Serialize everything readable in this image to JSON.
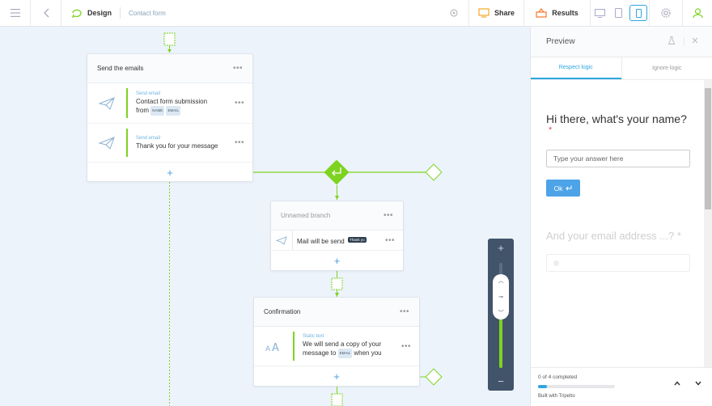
{
  "topbar": {
    "design_label": "Design",
    "form_name": "Contact form",
    "share_label": "Share",
    "results_label": "Results"
  },
  "canvas": {
    "send_block": {
      "title": "Send the emails",
      "items": [
        {
          "type": "Send email",
          "text_line1": "Contact form submission",
          "text_from": "from",
          "tag_name": "NAME",
          "tag_email": "EMAIL"
        },
        {
          "type": "Send email",
          "text": "Thank you for your message"
        }
      ]
    },
    "branch_block": {
      "title": "Unnamed branch",
      "item_text": "Mail will be send",
      "item_tag": "Thank yo"
    },
    "confirm_block": {
      "title": "Confirmation",
      "item_type": "Static text",
      "line1": "We will send a copy of your",
      "line2_pre": "message to",
      "line2_tag": "EMAIL",
      "line2_post": "when you"
    },
    "zoom_level": 0.6
  },
  "preview": {
    "title": "Preview",
    "tabs": [
      "Respect logic",
      "Ignore logic"
    ],
    "question1": "Hi there, what's your name?",
    "required_mark": "*",
    "answer_placeholder": "Type your answer here",
    "ok_label": "Ok",
    "question2": "And your email address ...? *",
    "progress_text": "0 of 4 completed",
    "progress": 0.12,
    "built_with": "Built with Tripetto"
  },
  "colors": {
    "accent": "#2ea7e0",
    "green": "#7ed321",
    "canvas_bg": "#ecf3fb"
  }
}
